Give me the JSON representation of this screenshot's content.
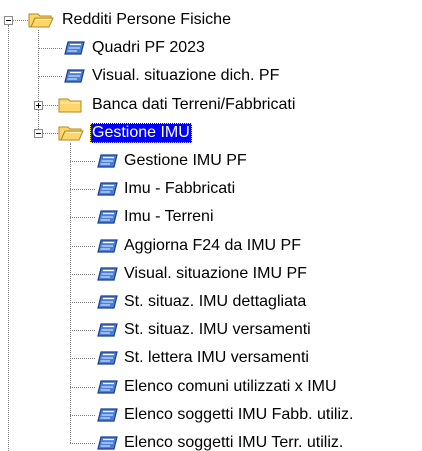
{
  "colors": {
    "selection_background": "#0000ff",
    "selection_text": "#ffffff",
    "folder_fill": "#ffd66b",
    "folder_outline": "#b08a1e",
    "program_icon_fill": "#4a7fd4",
    "program_icon_outline": "#1b3f8f",
    "tree_lines": "#7f7f7f"
  },
  "tree": {
    "root": {
      "label": "Redditi Persone Fisiche",
      "icon": "folder-open-icon",
      "expanded": true
    },
    "items": [
      {
        "label": "Quadri PF 2023",
        "icon": "program-icon"
      },
      {
        "label": "Visual. situazione dich. PF",
        "icon": "program-icon"
      },
      {
        "label": "Banca dati Terreni/Fabbricati",
        "icon": "folder-closed-icon",
        "expanded": false
      },
      {
        "label": "Gestione IMU",
        "icon": "folder-open-icon",
        "expanded": true,
        "selected": true
      }
    ],
    "imu_items": [
      {
        "label": "Gestione IMU PF",
        "icon": "program-icon"
      },
      {
        "label": "Imu - Fabbricati",
        "icon": "program-icon"
      },
      {
        "label": "Imu - Terreni",
        "icon": "program-icon"
      },
      {
        "label": "Aggiorna F24 da IMU PF",
        "icon": "program-icon"
      },
      {
        "label": "Visual. situazione IMU PF",
        "icon": "program-icon"
      },
      {
        "label": "St. situaz. IMU dettagliata",
        "icon": "program-icon"
      },
      {
        "label": "St. situaz. IMU versamenti",
        "icon": "program-icon"
      },
      {
        "label": "St. lettera IMU versamenti",
        "icon": "program-icon"
      },
      {
        "label": "Elenco comuni utilizzati x IMU",
        "icon": "program-icon"
      },
      {
        "label": "Elenco soggetti IMU  Fabb. utiliz.",
        "icon": "program-icon"
      },
      {
        "label": "Elenco soggetti IMU  Terr. utiliz.",
        "icon": "program-icon"
      }
    ]
  }
}
